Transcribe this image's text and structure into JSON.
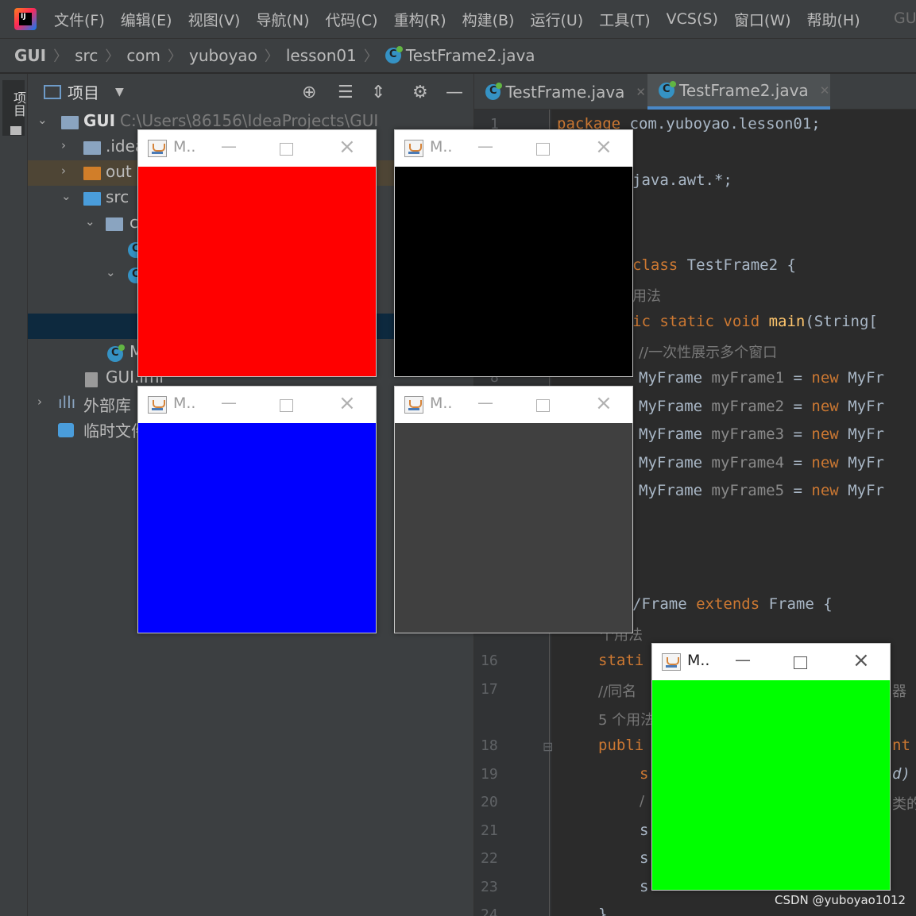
{
  "menubar": {
    "items": [
      "文件(F)",
      "编辑(E)",
      "视图(V)",
      "导航(N)",
      "代码(C)",
      "重构(R)",
      "构建(B)",
      "运行(U)",
      "工具(T)",
      "VCS(S)",
      "窗口(W)",
      "帮助(H)"
    ],
    "tail": "GU"
  },
  "breadcrumb": [
    "GUI",
    "src",
    "com",
    "yuboyao",
    "lesson01",
    "TestFrame2.java"
  ],
  "tool_strip": {
    "label": "项目"
  },
  "project": {
    "title": "项目",
    "root_label": "GUI",
    "root_path": "C:\\Users\\86156\\IdeaProjects\\GUI",
    "idea": ".idea",
    "out": "out",
    "src": "src",
    "pkg": "c",
    "class_m": "M",
    "iml": "GUI.iml",
    "ext_libs": "外部库",
    "scratch": "临时文件"
  },
  "tabs": [
    "TestFrame.java",
    "TestFrame2.java"
  ],
  "code": {
    "l1_kw": "package",
    "l1_rest": " com.yuboyao.lesson01;",
    "l3": "java.awt.*;",
    "l5_kw": "class",
    "l5_rest": " TestFrame2 {",
    "hint1": "用法",
    "l6_kw": "ic static void",
    "l6_fn": " main",
    "l6_rest": "(String[",
    "l7_cm": "//一次性展示多个窗口",
    "frames": [
      {
        "type": "MyFrame",
        "var": "myFrame1",
        "kw": "new",
        "ctor": "MyFr"
      },
      {
        "type": "MyFrame",
        "var": "myFrame2",
        "kw": "new",
        "ctor": "MyFr"
      },
      {
        "type": "MyFrame",
        "var": "myFrame3",
        "kw": "new",
        "ctor": "MyFr"
      },
      {
        "type": "MyFrame",
        "var": "myFrame4",
        "kw": "new",
        "ctor": "MyFr"
      },
      {
        "type": "MyFrame",
        "var": "myFrame5",
        "kw": "new",
        "ctor": "MyFr"
      }
    ],
    "l15_plain": "/Frame",
    "l15_kw": "extends",
    "l15_rest": " Frame {",
    "hint2": "个用法",
    "l16": "stati",
    "l17": "//同名",
    "l17_tail": "器",
    "hint3": "5 个用法",
    "l18": "publi",
    "l18_tail": "nt",
    "l19_tail": "d)",
    "l20_tail": "类的",
    "s1": "s",
    "s2": "/",
    "s3": "s",
    "s4": "s",
    "s5": "s",
    "l24": "}"
  },
  "line_numbers": [
    "1",
    "8",
    "16",
    "17",
    "18",
    "19",
    "20",
    "21",
    "22",
    "23",
    "24"
  ],
  "awt_windows": [
    {
      "title": "M..",
      "color": "#ff0000",
      "active": false
    },
    {
      "title": "M..",
      "color": "#000000",
      "active": false
    },
    {
      "title": "M..",
      "color": "#0000ff",
      "active": false
    },
    {
      "title": "M..",
      "color": "#404040",
      "active": false
    },
    {
      "title": "M..",
      "color": "#00ff00",
      "active": true
    }
  ],
  "watermark": "CSDN @yuboyao1012"
}
